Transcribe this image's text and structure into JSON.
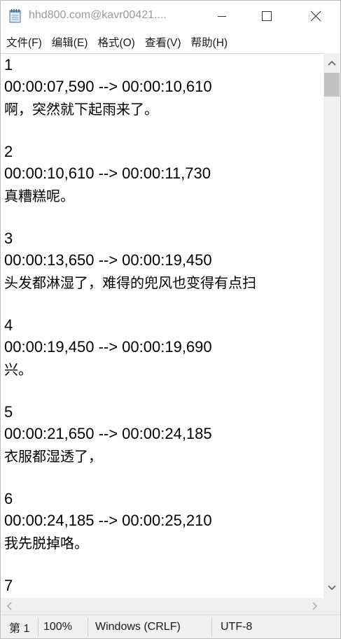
{
  "window": {
    "title": "hhd800.com@kavr00421...."
  },
  "menu": {
    "items": [
      "文件(F)",
      "编辑(E)",
      "格式(O)",
      "查看(V)",
      "帮助(H)"
    ]
  },
  "editor": {
    "lines": [
      "1",
      "00:00:07,590 --> 00:00:10,610",
      "啊，突然就下起雨来了。",
      "",
      "2",
      "00:00:10,610 --> 00:00:11,730",
      "真糟糕呢。",
      "",
      "3",
      "00:00:13,650 --> 00:00:19,450",
      "头发都淋湿了，难得的兜风也变得有点扫",
      "",
      "4",
      "00:00:19,450 --> 00:00:19,690",
      "兴。",
      "",
      "5",
      "00:00:21,650 --> 00:00:24,185",
      "衣服都湿透了，",
      "",
      "6",
      "00:00:24,185 --> 00:00:25,210",
      "我先脱掉咯。",
      "",
      "7"
    ]
  },
  "status": {
    "position": "第 1",
    "zoom": "100%",
    "line_ending": "Windows (CRLF)",
    "encoding": "UTF-8"
  }
}
